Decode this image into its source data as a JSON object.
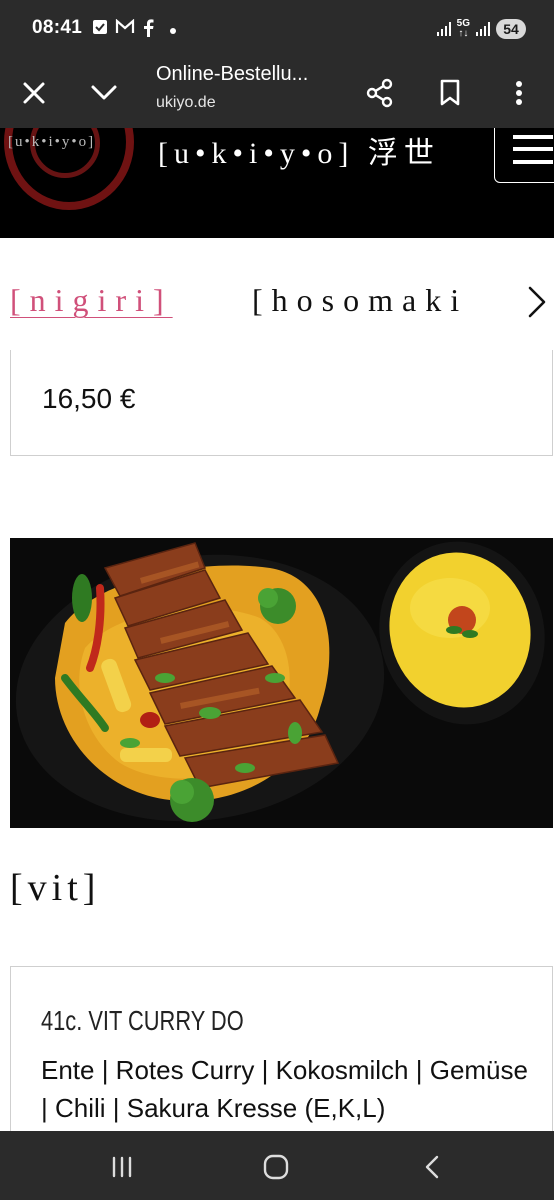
{
  "status_bar": {
    "time": "08:41",
    "network": "5G",
    "battery": "54",
    "icons": [
      "check-notification-icon",
      "gmail-icon",
      "facebook-icon",
      "dot-icon",
      "wifi-signal-icon",
      "cell-signal-icon"
    ]
  },
  "browser": {
    "title": "Online-Bestellu...",
    "url": "ukiyo.de",
    "icons": [
      "close-icon",
      "chevron-down-icon",
      "share-icon",
      "bookmark-icon",
      "more-vert-icon"
    ]
  },
  "site": {
    "logo_small": "[u•k•i•y•o]",
    "brand": "[u•k•i•y•o] 浮世"
  },
  "categories": {
    "active": "[nigiri]",
    "next": "[hosomaki"
  },
  "previous_item": {
    "price": "16,50 €"
  },
  "section": {
    "title": "[vit]"
  },
  "item": {
    "name": "41c. VIT CURRY DO",
    "description": "Ente | Rotes Curry | Kokosmilch | Gemüse | Chili | Sakura Kresse (E,K,L)"
  },
  "colors": {
    "accent": "#d0507a",
    "chrome": "#2b2b2b"
  }
}
